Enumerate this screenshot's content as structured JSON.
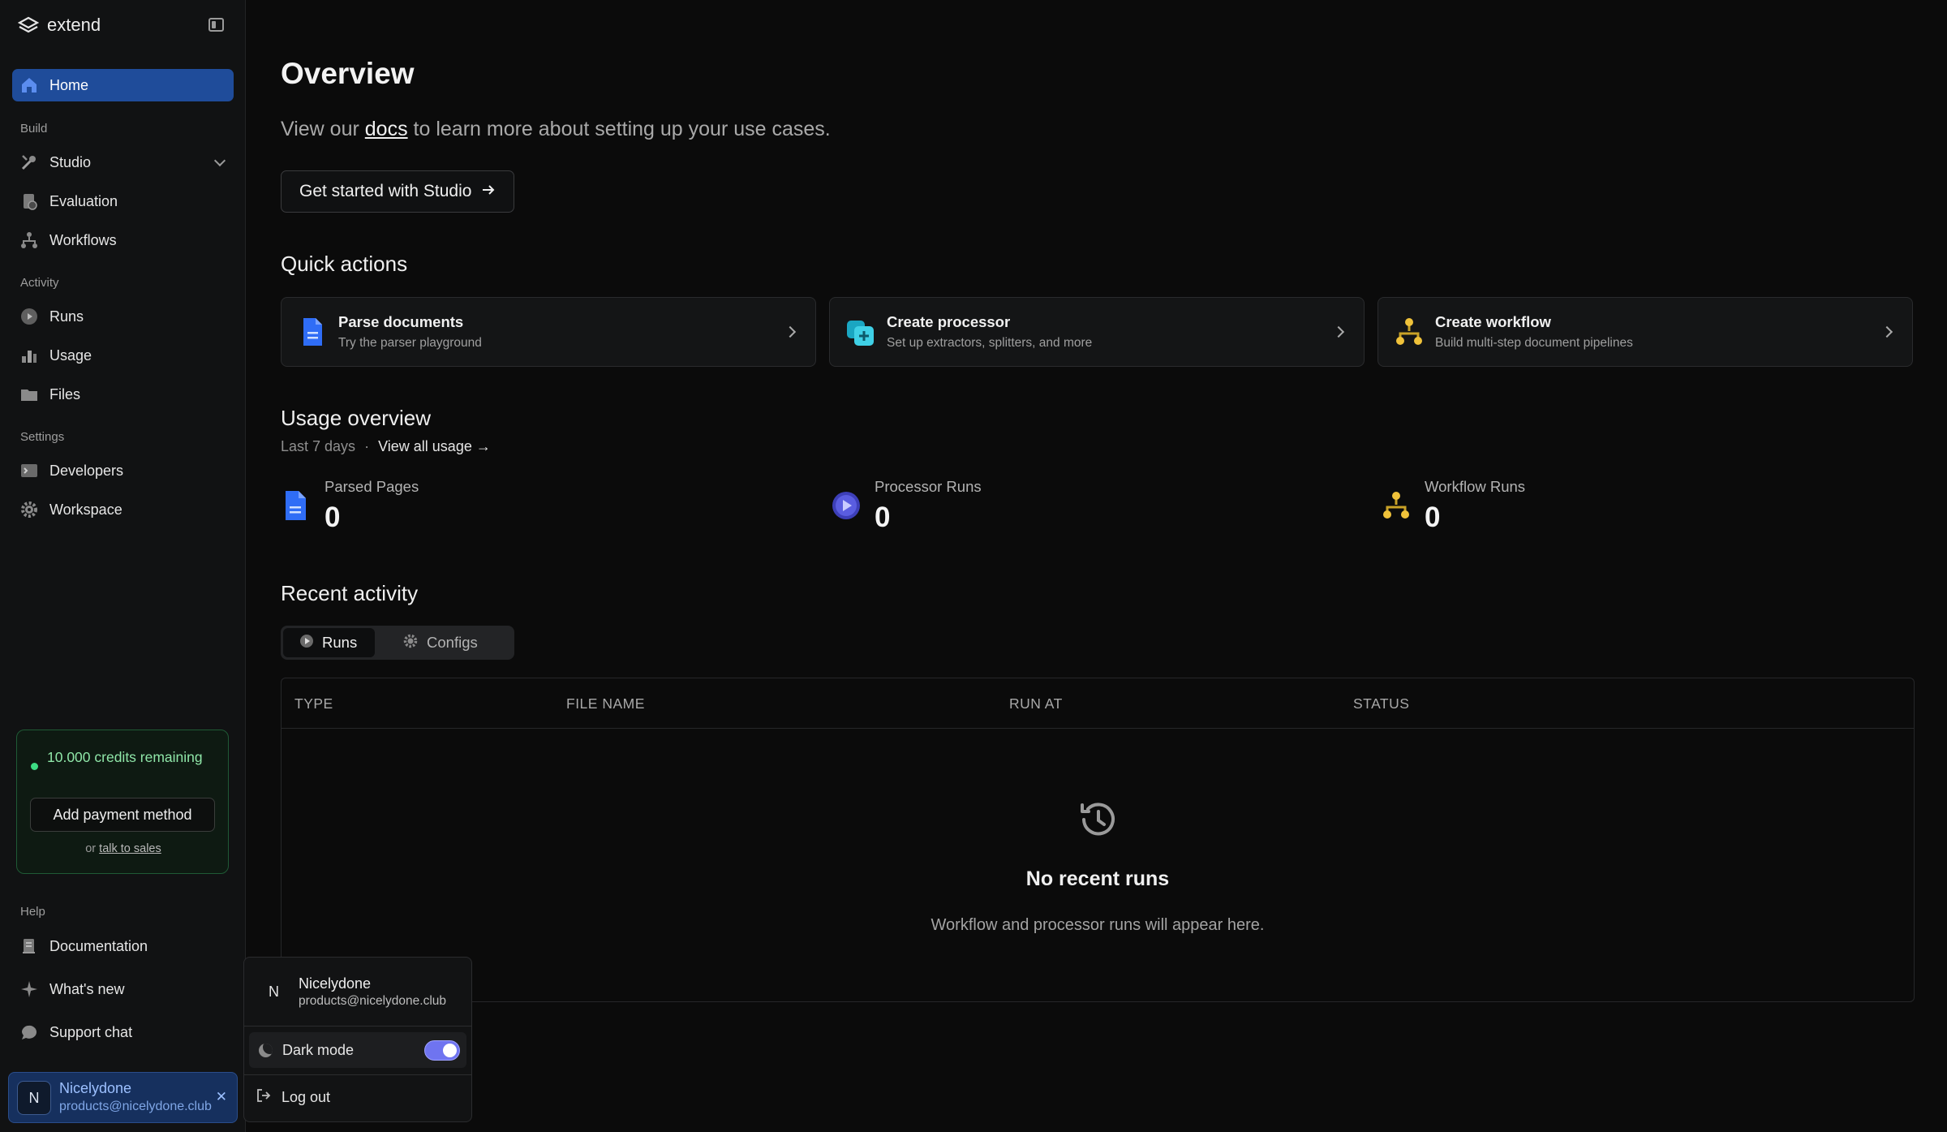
{
  "brand": {
    "name": "extend"
  },
  "sidebar": {
    "home": "Home",
    "sections": {
      "build": "Build",
      "activity": "Activity",
      "settings": "Settings",
      "help": "Help"
    },
    "build_items": [
      "Studio",
      "Evaluation",
      "Workflows"
    ],
    "activity_items": [
      "Runs",
      "Usage",
      "Files"
    ],
    "settings_items": [
      "Developers",
      "Workspace"
    ],
    "help_items": [
      "Documentation",
      "What's new",
      "Support chat"
    ],
    "credits": {
      "text": "10.000 credits remaining",
      "button": "Add payment method",
      "or": "or",
      "link": "talk to sales"
    },
    "user": {
      "initial": "N",
      "name": "Nicelydone",
      "email": "products@nicelydone.club"
    }
  },
  "popup": {
    "initial": "N",
    "name": "Nicelydone",
    "email": "products@nicelydone.club",
    "dark_mode_label": "Dark mode",
    "logout_label": "Log out"
  },
  "main": {
    "title": "Overview",
    "subtitle_pre": "View our",
    "subtitle_link": "docs",
    "subtitle_post": "to learn more about setting up your use cases.",
    "cta": "Get started with Studio",
    "quick_actions_title": "Quick actions",
    "quick_actions": [
      {
        "title": "Parse documents",
        "sub": "Try the parser playground"
      },
      {
        "title": "Create processor",
        "sub": "Set up extractors, splitters, and more"
      },
      {
        "title": "Create workflow",
        "sub": "Build multi-step document pipelines"
      }
    ],
    "usage_title": "Usage overview",
    "usage_range": "Last 7 days",
    "usage_sep": "·",
    "usage_link": "View all usage →",
    "stats": [
      {
        "label": "Parsed Pages",
        "value": "0"
      },
      {
        "label": "Processor Runs",
        "value": "0"
      },
      {
        "label": "Workflow Runs",
        "value": "0"
      }
    ],
    "recent_title": "Recent activity",
    "tabs": [
      "Runs",
      "Configs"
    ],
    "columns": [
      "TYPE",
      "FILE NAME",
      "RUN AT",
      "STATUS"
    ],
    "empty_title": "No recent runs",
    "empty_sub": "Workflow and processor runs will appear here."
  },
  "colors": {
    "accent": "#1f4c9a",
    "success": "#3ddc84",
    "toggle": "#6f74f0"
  }
}
